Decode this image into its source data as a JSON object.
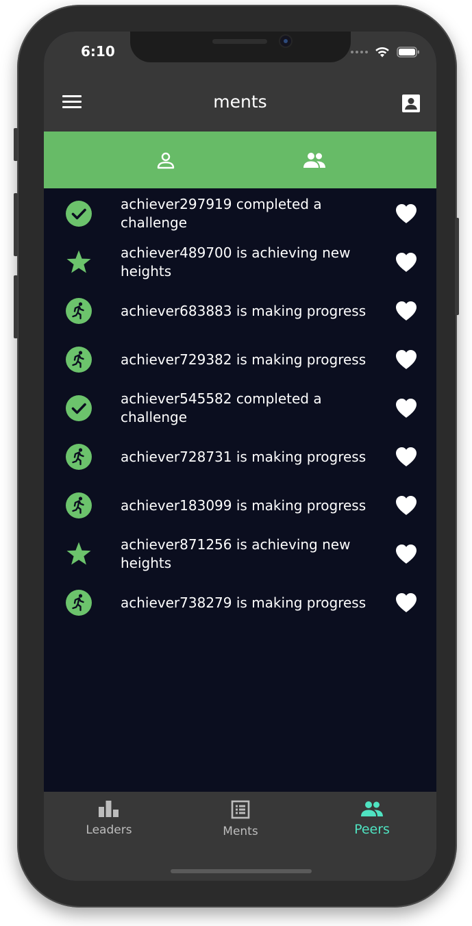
{
  "status_bar": {
    "time": "6:10"
  },
  "header": {
    "title": "ments"
  },
  "tabs": [
    {
      "icon": "person-outline-icon",
      "active": false
    },
    {
      "icon": "people-icon",
      "active": true
    }
  ],
  "feed": [
    {
      "icon": "check-circle-icon",
      "text": "achiever297919 completed a challenge"
    },
    {
      "icon": "star-icon",
      "text": "achiever489700 is achieving new heights"
    },
    {
      "icon": "running-person-icon",
      "text": "achiever683883 is making progress"
    },
    {
      "icon": "running-person-icon",
      "text": "achiever729382 is making progress"
    },
    {
      "icon": "check-circle-icon",
      "text": "achiever545582 completed a challenge"
    },
    {
      "icon": "running-person-icon",
      "text": "achiever728731 is making progress"
    },
    {
      "icon": "running-person-icon",
      "text": "achiever183099 is making progress"
    },
    {
      "icon": "star-icon",
      "text": "achiever871256 is achieving new heights"
    },
    {
      "icon": "running-person-icon",
      "text": "achiever738279 is making progress"
    }
  ],
  "bottom_nav": [
    {
      "label": "Leaders",
      "icon": "bar-chart-icon",
      "active": false
    },
    {
      "label": "Ments",
      "icon": "list-box-icon",
      "active": false
    },
    {
      "label": "Peers",
      "icon": "people-icon",
      "active": true
    }
  ],
  "colors": {
    "accent_green": "#67bb67",
    "icon_green": "#6cc36c",
    "active_nav": "#4fe3c1",
    "inactive_nav": "#bdbdbd",
    "feed_background": "#0b0e1f",
    "bar_background": "#383838"
  }
}
